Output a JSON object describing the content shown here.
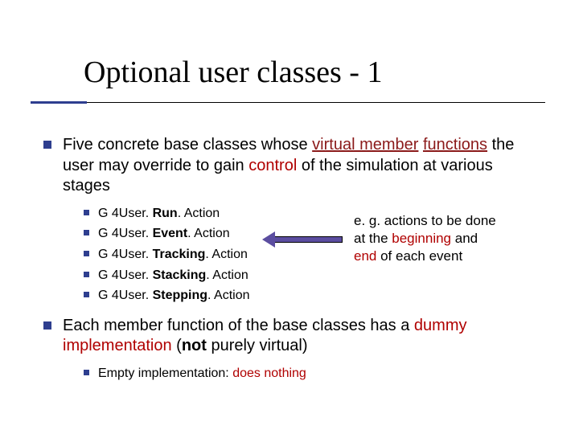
{
  "title": "Optional user classes - 1",
  "bullet1": {
    "p1": "Five concrete base classes whose ",
    "vm": "virtual member",
    "nl": " ",
    "fn": "functions",
    "p2": " the user may override to gain ",
    "ctrl": "control",
    "p3": " of the simulation at various stages"
  },
  "classes": {
    "pre": "G 4User. ",
    "c1": "Run",
    "c2": "Event",
    "c3": "Tracking",
    "c4": "Stacking",
    "c5": "Stepping",
    "suf": ". Action"
  },
  "annotation": {
    "l1a": "e. g. actions to be done",
    "l2a": "at the ",
    "l2b": "beginning",
    "l2c": " and",
    "l3a": "end",
    "l3b": " of each event"
  },
  "bullet2": {
    "p1": "Each member function of the base classes has a ",
    "di": "dummy implementation",
    "p2": " (",
    "not": "not",
    "p3": " purely virtual)"
  },
  "sub2": {
    "p1": "Empty implementation: ",
    "dn": "does nothing"
  }
}
